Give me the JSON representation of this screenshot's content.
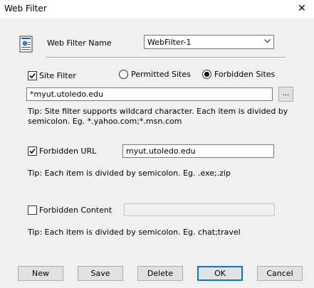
{
  "window": {
    "title": "Web Filter",
    "close_glyph": "✕"
  },
  "filter_name": {
    "label": "Web Filter Name",
    "value": "WebFilter-1",
    "icon": "document-icon"
  },
  "site_filter": {
    "label": "Site Filter",
    "checked": true,
    "options": [
      "Permitted Sites",
      "Forbidden Sites"
    ],
    "selected": "Forbidden Sites",
    "value": "*myut.utoledo.edu",
    "browse_label": "...",
    "tip_line1": "Tip: Site filter supports wildcard character. Each item is divided by",
    "tip_line2": "semicolon. Eg. *.yahoo.com;*.msn.com"
  },
  "forbidden_url": {
    "label": "Forbidden URL",
    "checked": true,
    "value": "myut.utoledo.edu",
    "tip": "Tip: Each item is divided by semicolon. Eg. .exe;.zip"
  },
  "forbidden_content": {
    "label": "Forbidden Content",
    "checked": false,
    "value": "",
    "tip": "Tip: Each item is divided by semicolon. Eg. chat;travel"
  },
  "buttons": {
    "new": "New",
    "save": "Save",
    "delete": "Delete",
    "ok": "OK",
    "cancel": "Cancel"
  },
  "colors": {
    "background": "#f0f0f0",
    "focus": "#0078d7"
  }
}
